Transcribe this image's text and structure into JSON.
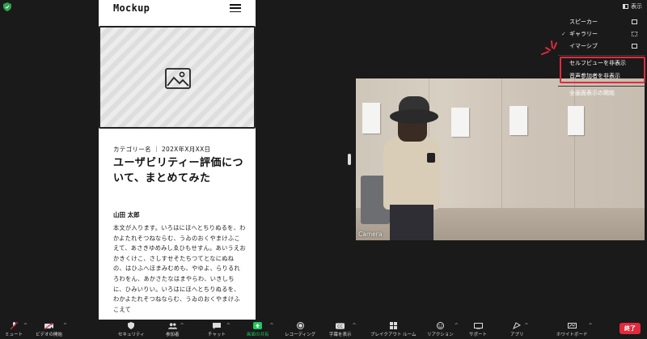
{
  "top_bar": {
    "view_label": "表示"
  },
  "mockup": {
    "logo": "Mockup",
    "meta": "カテゴリー名 ｜ 202X年X月XX日",
    "title": "ユーザビリティー評価について、まとめてみた",
    "author": "山田 太郎",
    "body": "本文が入ります。いろはにほへとちりぬるを、わかよたれそつねならむ、うゐのおくやまけふこえて、あさきゆめみしゑひもせすん。あいうえおかきくけこ、さしすせそたちつてとなにぬねの、はひふへほまみむめも、やゆよ、らりるれろわをん、あかさたなはまやらわ、いきしちに、ひみいりい。いろはにほへとちりぬるを、わかよたれそつねならむ、うゐのおくやまけふこえて"
  },
  "camera": {
    "label": "Camera"
  },
  "view_menu": {
    "items": [
      {
        "label": "スピーカー",
        "checked": false,
        "icon": "grid-1-icon"
      },
      {
        "label": "ギャラリー",
        "checked": true,
        "icon": "grid-3-icon"
      },
      {
        "label": "イマーシブ",
        "checked": false,
        "icon": "person-icon"
      }
    ],
    "hide_self_view": "セルフビューを非表示",
    "hide_audio": "音声参加者を非表示",
    "fullscreen": "全画面表示の開始"
  },
  "toolbar": {
    "mute": "ミュート",
    "video": "ビデオの開始",
    "security": "セキュリティ",
    "participants": "参加者",
    "participants_count": "2",
    "chat": "チャット",
    "share": "画面の共有",
    "record": "レコーディング",
    "captions": "字幕を表示",
    "layout": "ブレイクアウト ルーム",
    "reactions": "リアクション",
    "support": "サポート",
    "apps": "アプリ",
    "whiteboard": "ホワイトボード",
    "end": "終了",
    "share_color": "#22c55e",
    "end_color": "#e02b3c"
  }
}
